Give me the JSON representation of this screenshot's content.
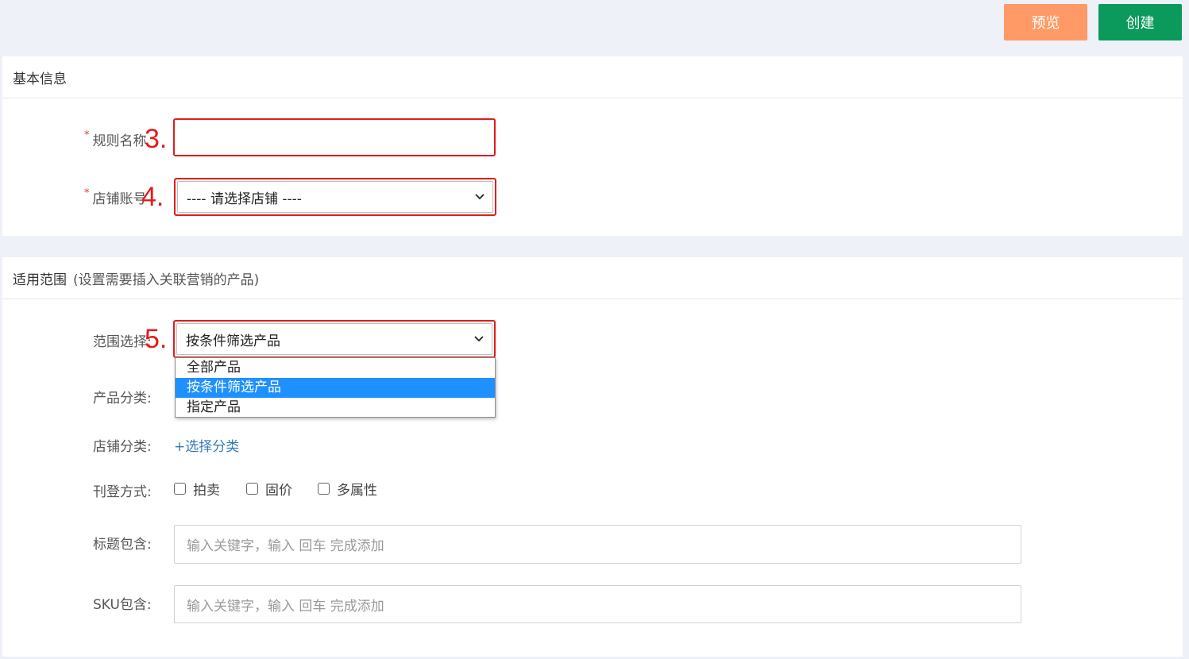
{
  "toolbar": {
    "preview_label": "预览",
    "create_label": "创建"
  },
  "basic_info": {
    "title": "基本信息",
    "rule_name": {
      "label": "规则名称",
      "required_mark": "*",
      "value": ""
    },
    "store_account": {
      "label": "店铺账号",
      "required_mark": "*",
      "selected": "---- 请选择店铺 ----"
    }
  },
  "scope": {
    "title": "适用范围",
    "hint": "(设置需要插入关联营销的产品)",
    "range_select": {
      "label": "范围选择:",
      "selected": "按条件筛选产品",
      "options": [
        "全部产品",
        "按条件筛选产品",
        "指定产品"
      ],
      "highlighted_index": 1
    },
    "product_category": {
      "label": "产品分类:"
    },
    "store_category": {
      "label": "店铺分类:",
      "link": "+选择分类"
    },
    "listing_type": {
      "label": "刊登方式:",
      "options": [
        {
          "label": "拍卖",
          "checked": false
        },
        {
          "label": "固价",
          "checked": false
        },
        {
          "label": "多属性",
          "checked": false
        }
      ]
    },
    "title_contains": {
      "label": "标题包含:",
      "placeholder": "输入关键字，输入 回车 完成添加"
    },
    "sku_contains": {
      "label": "SKU包含:",
      "placeholder": "输入关键字，输入 回车 完成添加"
    }
  },
  "annotations": [
    "3.",
    "4.",
    "5."
  ],
  "colors": {
    "preview": "#ff9966",
    "create": "#0b9a5b",
    "annotation": "#e31b1b",
    "highlight": "#1e90ff",
    "link": "#337ab7"
  }
}
